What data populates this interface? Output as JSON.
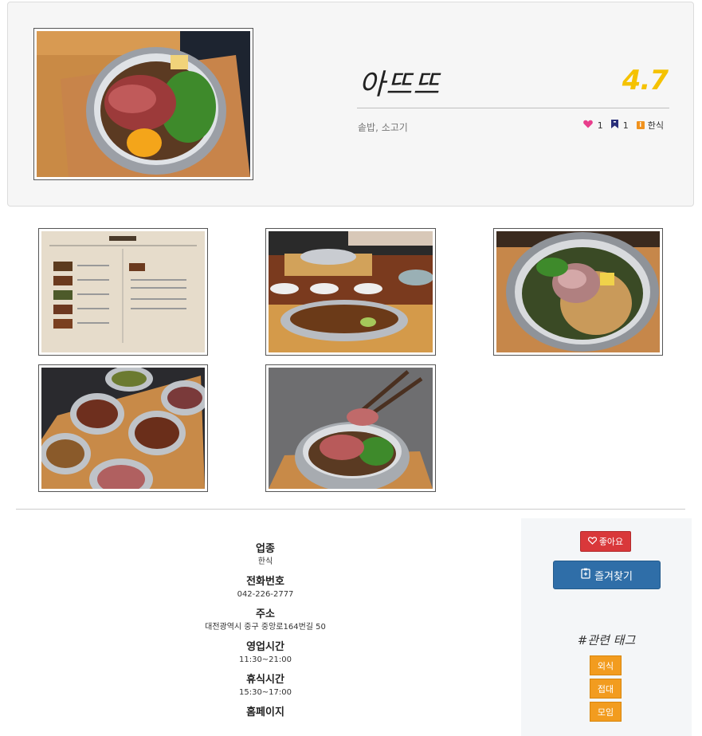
{
  "restaurant": {
    "name": "아뜨뜨",
    "rating": "4.7",
    "menu_tags": "솥밥, 소고기",
    "likes": "1",
    "bookmarks": "1",
    "category": "한식"
  },
  "info": [
    {
      "label": "업종",
      "value": "한식"
    },
    {
      "label": "전화번호",
      "value": "042-226-2777"
    },
    {
      "label": "주소",
      "value": "대전광역시 중구 중앙로164번길 50"
    },
    {
      "label": "영업시간",
      "value": "11:30~21:00"
    },
    {
      "label": "휴식시간",
      "value": "15:30~17:00"
    },
    {
      "label": "홈페이지",
      "value": ""
    }
  ],
  "actions": {
    "like_label": "좋아요",
    "favorite_label": "즐겨찾기"
  },
  "tags": {
    "title": "#관련 태그",
    "items": [
      "외식",
      "접대",
      "모임"
    ]
  },
  "icons": {
    "like": "heart-icon",
    "bookmark": "bookmark-icon",
    "category": "info-icon",
    "favorite": "clipboard-icon"
  },
  "colors": {
    "rating": "#f5c200",
    "like_button": "#d9383a",
    "favorite_button": "#2f6ea8",
    "tag_chip": "#f29c1f"
  }
}
